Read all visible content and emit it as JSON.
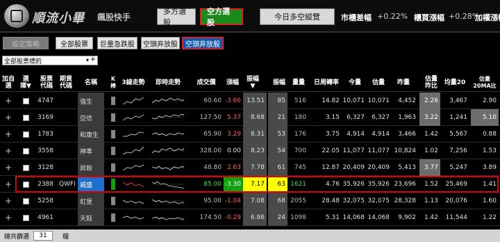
{
  "app": {
    "title": "順流小畢",
    "subtitle": "飆股快手"
  },
  "top": {
    "btn_long": "多方選股",
    "btn_short": "空方選股",
    "btn_stat": "今日多空縱覽",
    "otc_label": "市櫃差幅",
    "otc_value": "+0.22%",
    "listed_label": "櫃買漲幅",
    "listed_value": "+0.28%",
    "weighted_label": "加權漲幅"
  },
  "strategy": {
    "set_strategy": "設定策略",
    "all_stocks": "全部股票",
    "big_drop": "巨量急跌股",
    "short_release": "空頭弃放股",
    "short_release2": "空頭弃放股"
  },
  "dropdown": {
    "value": "全部股票標的",
    "arrow": "▾",
    "plus": "+"
  },
  "headers": {
    "add": "加自\n選",
    "pick": "選\n擇▼",
    "code": "股票\n代碼",
    "fcode": "期貨\n代碼",
    "name": "名稱",
    "k": "K\n棒",
    "kday": "3線走勢",
    "intraday": "即時走勢",
    "price": "成交價",
    "change": "漲幅",
    "amp": "振幅 ▼",
    "amp2": "振幅",
    "vol": "量量",
    "turnover": "日周轉率",
    "today": "今量",
    "est": "估量",
    "yest": "昨量",
    "est_ratio": "估量\n昨比",
    "avg20": "均量20",
    "est20": "估量\n20MA比"
  },
  "rows": [
    {
      "code": "4747",
      "fcode": "",
      "name": "強生",
      "price": "60.60",
      "change": "-3.66",
      "amp": "13.51",
      "amp2": "85",
      "vol": "516",
      "turnover": "14.82",
      "today": "10,071",
      "est": "10,071",
      "yest": "4,452",
      "ratio": "2.26",
      "avg20": "3,467",
      "ma20": "2.90"
    },
    {
      "code": "3169",
      "fcode": "",
      "name": "亞信",
      "price": "127.50",
      "change": "5.37",
      "amp": "8.68",
      "amp2": "21",
      "vol": "180",
      "turnover": "3.15",
      "today": "6,327",
      "est": "6,327",
      "yest": "1,963",
      "ratio": "3.22",
      "avg20": "1,241",
      "ma20": "5.10"
    },
    {
      "code": "1783",
      "fcode": "",
      "name": "和康生",
      "price": "65.90",
      "change": "3.29",
      "amp": "8.31",
      "amp2": "53",
      "vol": "176",
      "turnover": "3.75",
      "today": "4,914",
      "est": "4,914",
      "yest": "3,466",
      "ratio": "1.42",
      "avg20": "5,567",
      "ma20": "0.88"
    },
    {
      "code": "3558",
      "fcode": "",
      "name": "神準",
      "price": "328.00",
      "change": "0.00",
      "amp": "8.23",
      "amp2": "54",
      "vol": "700",
      "turnover": "22.05",
      "today": "11,077",
      "est": "11,077",
      "yest": "10,824",
      "ratio": "1.02",
      "avg20": "7,256",
      "ma20": "1.53"
    },
    {
      "code": "3128",
      "fcode": "",
      "name": "昇銳",
      "price": "48.80",
      "change": "2.63",
      "amp": "7.78",
      "amp2": "61",
      "vol": "745",
      "turnover": "12.87",
      "today": "20,409",
      "est": "20,409",
      "yest": "5,413",
      "ratio": "3.77",
      "avg20": "5,247",
      "ma20": "3.89"
    },
    {
      "code": "2388",
      "fcode": "QWFI",
      "name": "威盛",
      "price": "85.00",
      "change": "-3.30",
      "amp": "7.17",
      "amp2": "63",
      "vol": "1621",
      "turnover": "4.76",
      "today": "35,926",
      "est": "35,926",
      "yest": "23,696",
      "ratio": "1.52",
      "avg20": "25,469",
      "ma20": "1.41"
    },
    {
      "code": "5258",
      "fcode": "",
      "name": "虹堡",
      "price": "95.00",
      "change": "-1.04",
      "amp": "7.08",
      "amp2": "68",
      "vol": "2055",
      "turnover": "28.48",
      "today": "32,075",
      "est": "32,075",
      "yest": "28,328",
      "ratio": "1.13",
      "avg20": "20,076",
      "ma20": "1.60"
    },
    {
      "code": "4961",
      "fcode": "",
      "name": "天鈺",
      "price": "174.50",
      "change": "-0.29",
      "amp": "6.86",
      "amp2": "24",
      "vol": "1098",
      "turnover": "5.31",
      "today": "14,068",
      "est": "14,068",
      "yest": "9,902",
      "ratio": "1.42",
      "avg20": "11,544",
      "ma20": "1.22"
    }
  ],
  "footer": {
    "label": "總共篩選",
    "count": "31",
    "unit": "檔"
  }
}
